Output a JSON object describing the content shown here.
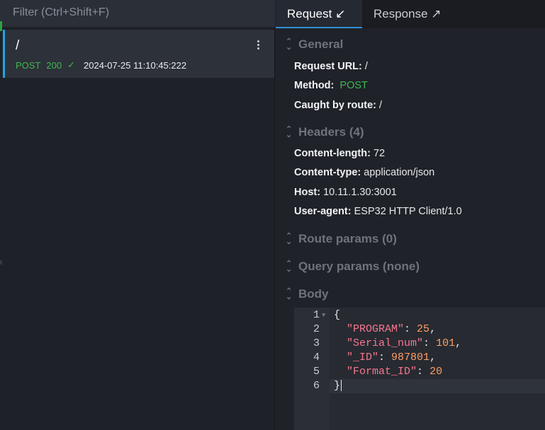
{
  "filter": {
    "placeholder": "Filter (Ctrl+Shift+F)"
  },
  "request_item": {
    "path": "/",
    "method": "POST",
    "status": "200",
    "timestamp": "2024-07-25 11:10:45:222",
    "status_icon": "check-icon",
    "menu_icon": "kebab-menu-icon"
  },
  "tabs": [
    {
      "label": "Request",
      "arrow": "↙",
      "active": true
    },
    {
      "label": "Response",
      "arrow": "↗",
      "active": false
    }
  ],
  "general": {
    "title": "General",
    "request_url_label": "Request URL:",
    "request_url_value": "/",
    "method_label": "Method:",
    "method_value": "POST",
    "route_label": "Caught by route:",
    "route_value": "/"
  },
  "headers": {
    "title": "Headers (4)",
    "items": [
      {
        "label": "Content-length:",
        "value": "72"
      },
      {
        "label": "Content-type:",
        "value": "application/json"
      },
      {
        "label": "Host:",
        "value": "10.11.1.30:3001"
      },
      {
        "label": "User-agent:",
        "value": "ESP32 HTTP Client/1.0"
      }
    ]
  },
  "route_params": {
    "title": "Route params (0)"
  },
  "query_params": {
    "title": "Query params (none)"
  },
  "body": {
    "title": "Body",
    "line_numbers": [
      "1",
      "2",
      "3",
      "4",
      "5",
      "6"
    ],
    "open_brace": "{",
    "close_brace": "}",
    "fields": [
      {
        "key": "\"PROGRAM\"",
        "value": "25",
        "sep": ","
      },
      {
        "key": "\"Serial_num\"",
        "value": "101",
        "sep": ","
      },
      {
        "key": "\"_ID\"",
        "value": "987801",
        "sep": ","
      },
      {
        "key": "\"Format_ID\"",
        "value": "20",
        "sep": ""
      }
    ]
  },
  "colors": {
    "accent_blue": "#2f8fd8",
    "method_green": "#3fb950",
    "json_key": "#f7768e",
    "json_number": "#ff9e64"
  }
}
